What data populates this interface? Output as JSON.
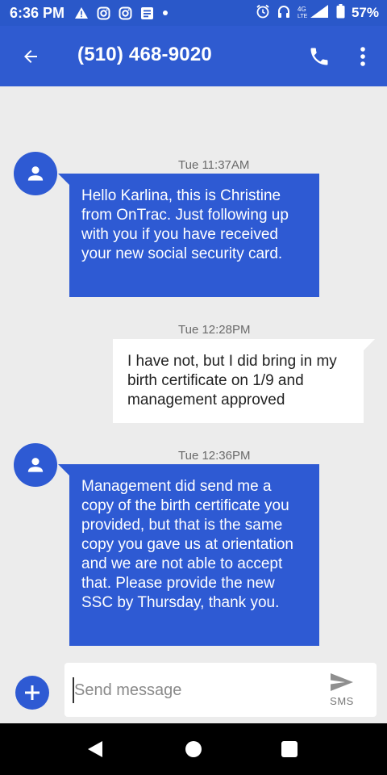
{
  "status_bar": {
    "time": "6:36 PM",
    "left_icons": [
      "warning-icon",
      "instagram-icon",
      "instagram-icon",
      "news-icon",
      "dot-icon"
    ],
    "right_icons": [
      "alarm-icon",
      "headphones-icon",
      "lte-signal-icon",
      "battery-icon"
    ],
    "network_label": "4G LTE",
    "battery": "57%"
  },
  "app_bar": {
    "title": "(510) 468-9020",
    "back_icon": "arrow-back-icon",
    "call_icon": "phone-icon",
    "menu_icon": "more-vert-icon"
  },
  "messages": [
    {
      "direction": "incoming",
      "timestamp": "Tue 11:37AM",
      "text": "Hello Karlina, this is Christine from OnTrac. Just following up with you if you have received your new social security card."
    },
    {
      "direction": "outgoing",
      "timestamp": "Tue 12:28PM",
      "text": "I have not, but I did bring in my birth certificate on 1/9 and management approved"
    },
    {
      "direction": "incoming",
      "timestamp": "Tue 12:36PM",
      "text": "Management did send me a copy of the birth certificate you provided, but that is the same copy you gave us at orientation and we are not able to accept that. Please provide the new SSC by Thursday, thank you."
    }
  ],
  "compose": {
    "placeholder": "Send message",
    "value": "",
    "send_label": "SMS"
  },
  "colors": {
    "status_bar": "#2a58c9",
    "app_bar": "#2f5bd0",
    "accent": "#2e5ad3",
    "background": "#ececec",
    "outgoing_bubble": "#ffffff"
  }
}
